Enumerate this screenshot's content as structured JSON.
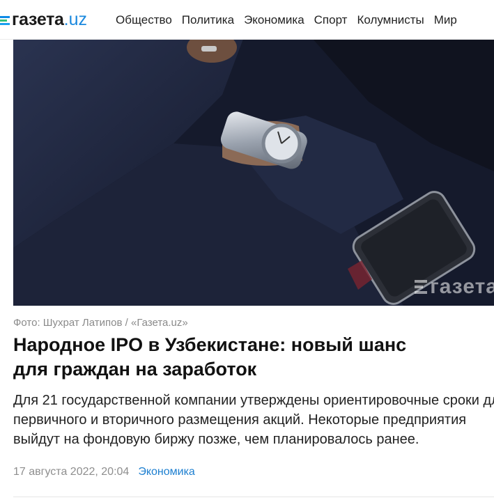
{
  "header": {
    "logo_main": "газета",
    "logo_tld": ".uz",
    "nav": [
      "Общество",
      "Политика",
      "Экономика",
      "Спорт",
      "Колумнисты",
      "Мир"
    ]
  },
  "article": {
    "photo_watermark": "газета",
    "photo_credit": "Фото: Шухрат Латипов / «Газета.uz»",
    "title": "Народное IPO в Узбекистане: новый шанс для граждан на заработок",
    "lead": "Для 21 государственной компании утверждены ориентировочные сроки для первичного и вторичного размещения акций. Некоторые предприятия выйдут на фондовую биржу позже, чем планировалось ранее.",
    "date": "17 августа 2022, 20:04",
    "category": "Экономика"
  },
  "colors": {
    "accent": "#1d7fd0",
    "logo_tld": "#1a88de",
    "muted_text": "#8a8a8a"
  },
  "icons": [
    "gazeta-logo-icon",
    "watch-icon"
  ]
}
